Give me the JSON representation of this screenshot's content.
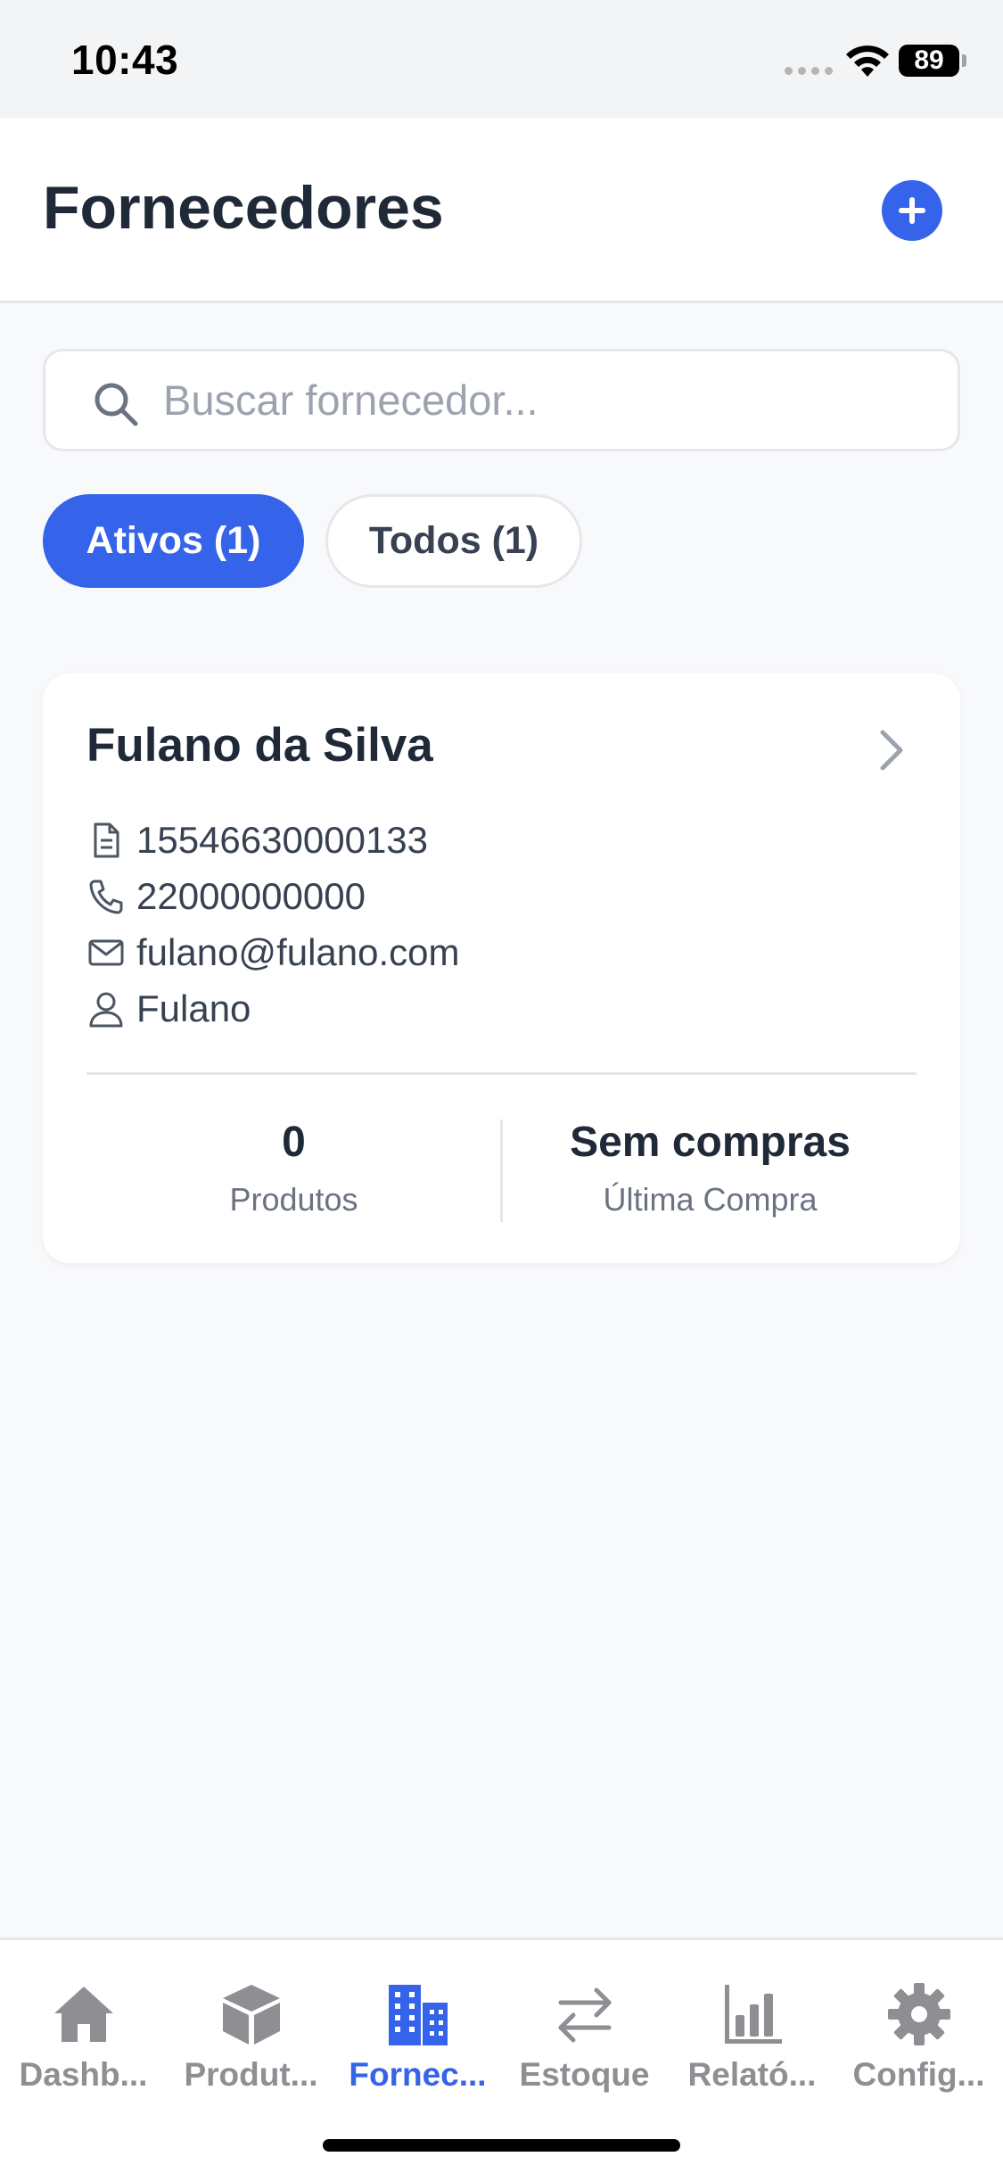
{
  "status_bar": {
    "time": "10:43",
    "battery": "89"
  },
  "header": {
    "title": "Fornecedores",
    "add_icon": "plus-icon"
  },
  "search": {
    "placeholder": "Buscar fornecedor..."
  },
  "filters": [
    {
      "label": "Ativos (1)",
      "active": true
    },
    {
      "label": "Todos (1)",
      "active": false
    }
  ],
  "supplier": {
    "name": "Fulano da Silva",
    "document": "15546630000133",
    "phone": "22000000000",
    "email": "fulano@fulano.com",
    "contact": "Fulano",
    "products_value": "0",
    "products_label": "Produtos",
    "last_purchase_value": "Sem compras",
    "last_purchase_label": "Última Compra"
  },
  "tabs": [
    {
      "label": "Dashb...",
      "icon": "home-icon",
      "active": false
    },
    {
      "label": "Produt...",
      "icon": "box-icon",
      "active": false
    },
    {
      "label": "Fornec...",
      "icon": "building-icon",
      "active": true
    },
    {
      "label": "Estoque",
      "icon": "transfer-icon",
      "active": false
    },
    {
      "label": "Relató...",
      "icon": "chart-icon",
      "active": false
    },
    {
      "label": "Config...",
      "icon": "gear-icon",
      "active": false
    }
  ],
  "colors": {
    "accent": "#3563e9",
    "inactive_tab": "#8e8e93",
    "background": "#f8f9fb"
  }
}
